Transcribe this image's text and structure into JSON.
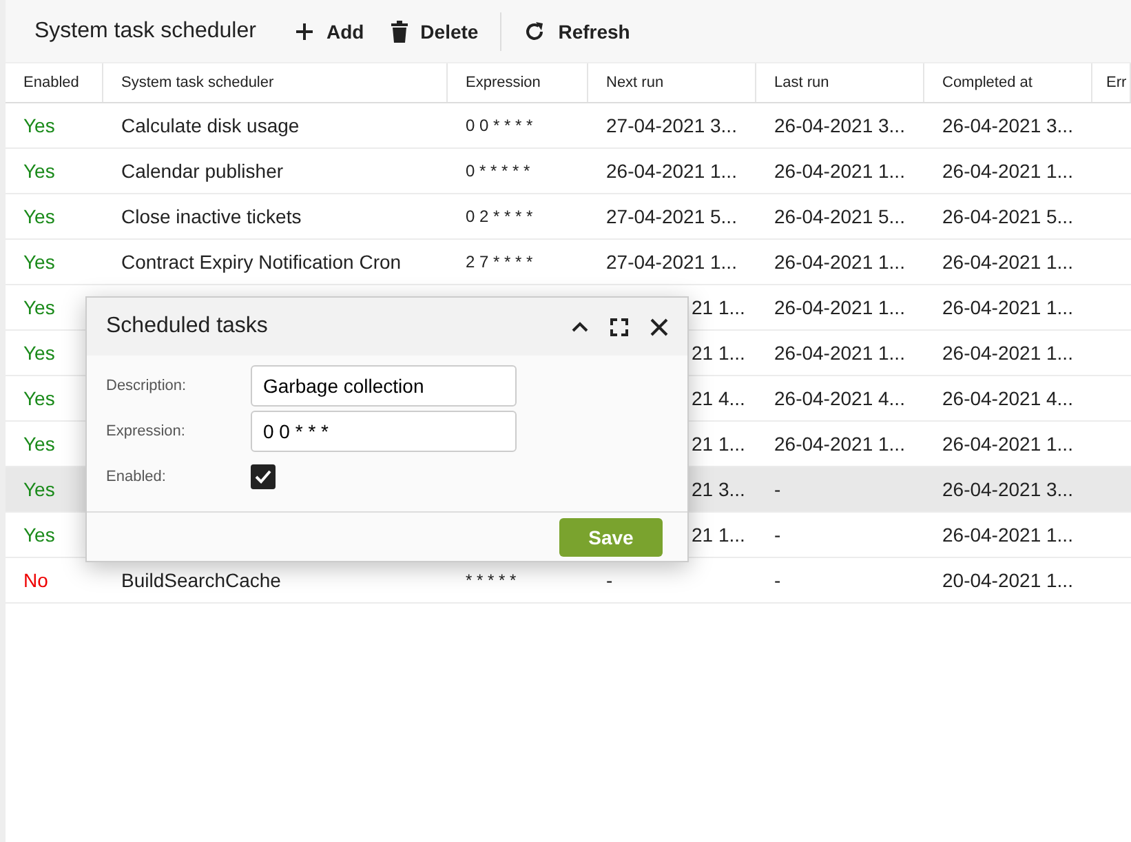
{
  "toolbar": {
    "title": "System task scheduler",
    "buttons": [
      {
        "kind": "add",
        "label": "Add"
      },
      {
        "kind": "delete",
        "label": "Delete"
      },
      {
        "kind": "refresh",
        "label": "Refresh"
      }
    ]
  },
  "table": {
    "columns": [
      "Enabled",
      "System task scheduler",
      "Expression",
      "Next run",
      "Last run",
      "Completed at",
      "Err"
    ],
    "rows": [
      {
        "enabled": true,
        "enabled_text": "Yes",
        "name": "Calculate disk usage",
        "expression": "0 0 * * * *",
        "next_run": "27-04-2021 3...",
        "last_run": "26-04-2021 3...",
        "completed_at": "26-04-2021 3...",
        "selected": false
      },
      {
        "enabled": true,
        "enabled_text": "Yes",
        "name": "Calendar publisher",
        "expression": "0 * * * * *",
        "next_run": "26-04-2021 1...",
        "last_run": "26-04-2021 1...",
        "completed_at": "26-04-2021 1...",
        "selected": false
      },
      {
        "enabled": true,
        "enabled_text": "Yes",
        "name": "Close inactive tickets",
        "expression": "0 2 * * * *",
        "next_run": "27-04-2021 5...",
        "last_run": "26-04-2021 5...",
        "completed_at": "26-04-2021 5...",
        "selected": false
      },
      {
        "enabled": true,
        "enabled_text": "Yes",
        "name": "Contract Expiry Notification Cron",
        "expression": "2 7 * * * *",
        "next_run": "27-04-2021 1...",
        "last_run": "26-04-2021 1...",
        "completed_at": "26-04-2021 1...",
        "selected": false
      },
      {
        "enabled": true,
        "enabled_text": "Yes",
        "next_run": "21 1...",
        "last_run": "26-04-2021 1...",
        "completed_at": "26-04-2021 1...",
        "selected": false
      },
      {
        "enabled": true,
        "enabled_text": "Yes",
        "next_run": "21 1...",
        "last_run": "26-04-2021 1...",
        "completed_at": "26-04-2021 1...",
        "selected": false
      },
      {
        "enabled": true,
        "enabled_text": "Yes",
        "next_run": "21 4...",
        "last_run": "26-04-2021 4...",
        "completed_at": "26-04-2021 4...",
        "selected": false
      },
      {
        "enabled": true,
        "enabled_text": "Yes",
        "next_run": "21 1...",
        "last_run": "26-04-2021 1...",
        "completed_at": "26-04-2021 1...",
        "selected": false
      },
      {
        "enabled": true,
        "enabled_text": "Yes",
        "next_run": "21 3...",
        "last_run": "-",
        "completed_at": "26-04-2021 3...",
        "selected": true
      },
      {
        "enabled": true,
        "enabled_text": "Yes",
        "next_run": "21 1...",
        "last_run": "-",
        "completed_at": "26-04-2021 1...",
        "selected": false
      },
      {
        "enabled": false,
        "enabled_text": "No",
        "name": "BuildSearchCache",
        "expression": "* * * * *",
        "next_run": "-",
        "last_run": "-",
        "completed_at": "20-04-2021 1...",
        "selected": false
      }
    ]
  },
  "dialog": {
    "title": "Scheduled tasks",
    "description_label": "Description:",
    "description": "Garbage collection",
    "expression_label": "Expression:",
    "expression": "0 0 * * *",
    "enabled_label": "Enabled:",
    "enabled": true,
    "save": "Save"
  }
}
